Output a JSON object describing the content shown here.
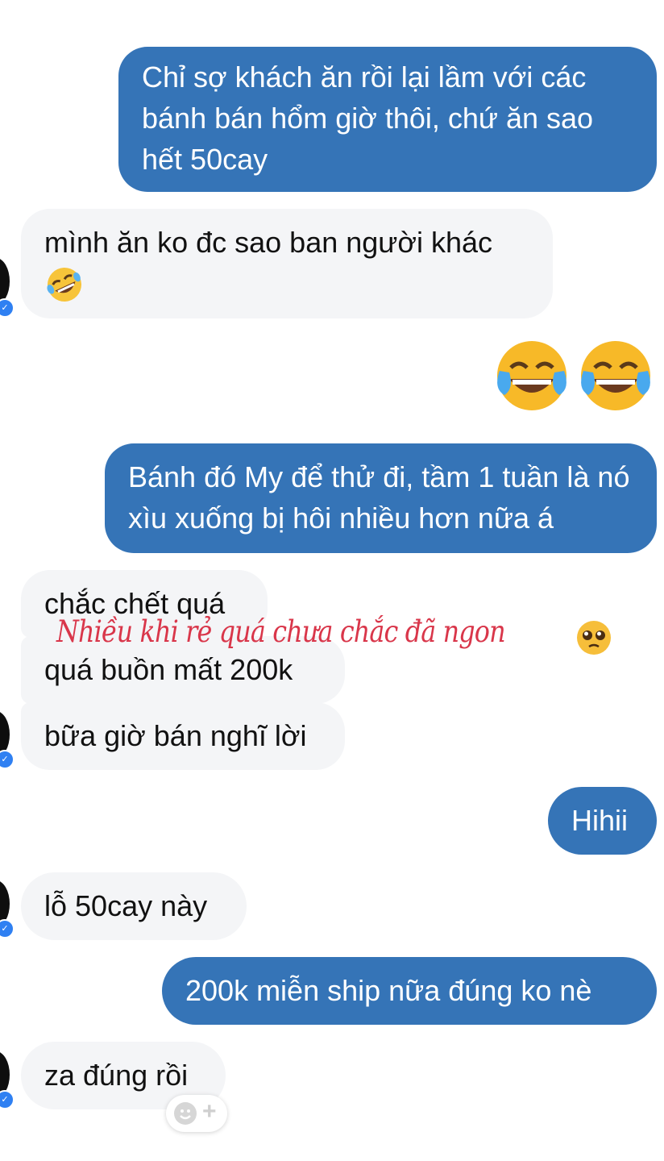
{
  "messages": [
    {
      "id": "m1",
      "dir": "out",
      "text": "Chỉ sợ khách ăn rồi lại lầm với các bánh bán hổm giờ thôi, chứ ăn sao hết 50cay"
    },
    {
      "id": "m2",
      "dir": "in",
      "text": "mình ăn ko đc sao ban người khác",
      "emoji": "rolling-on-floor-laughing"
    },
    {
      "id": "m3",
      "dir": "out",
      "emoji": [
        "face-with-tears-of-joy",
        "face-with-tears-of-joy"
      ]
    },
    {
      "id": "m4",
      "dir": "out",
      "text": "Bánh đó My để thử đi, tầm 1 tuần là nó xìu xuống bị hôi nhiều hơn nữa á"
    },
    {
      "id": "m5",
      "dir": "in",
      "text": "chắc chết quá"
    },
    {
      "id": "m6",
      "dir": "in",
      "text": "quá buồn mất 200k"
    },
    {
      "id": "m7",
      "dir": "in",
      "text": "bữa giờ bán nghĩ lời"
    },
    {
      "id": "m8",
      "dir": "out",
      "text": "Hihii"
    },
    {
      "id": "m9",
      "dir": "in",
      "text": "lỗ 50cay này"
    },
    {
      "id": "m10",
      "dir": "out",
      "text": "200k miễn ship nữa đúng ko nè"
    },
    {
      "id": "m11",
      "dir": "in",
      "text": "za đúng rồi"
    }
  ],
  "overlay": {
    "text": "Nhiều khi rẻ quá chưa chắc đã ngon",
    "emoji": "pleading-face",
    "color": "#d9364a"
  },
  "reaction_button": {
    "icon": "add-reaction-icon"
  },
  "colors": {
    "outgoing": "#3574b7",
    "incoming": "#f4f5f7",
    "verified": "#2f80f2"
  }
}
